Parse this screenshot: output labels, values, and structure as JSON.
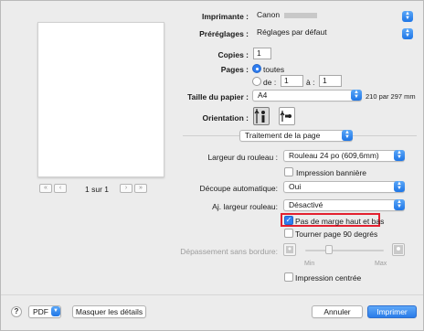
{
  "printer": {
    "label": "Imprimante :",
    "value": "Canon"
  },
  "presets": {
    "label": "Préréglages :",
    "value": "Réglages par défaut"
  },
  "copies": {
    "label": "Copies :",
    "value": "1"
  },
  "pages": {
    "label": "Pages :",
    "all_label": "toutes",
    "from_label": "de :",
    "from_value": "1",
    "to_label": "à :",
    "to_value": "1",
    "selected": "toutes"
  },
  "paper_size": {
    "label": "Taille du papier :",
    "value": "A4",
    "dimensions": "210 par 297 mm"
  },
  "orientation": {
    "label": "Orientation :",
    "selected": "portrait"
  },
  "section": {
    "value": "Traitement de la page"
  },
  "roll_width": {
    "label": "Largeur du rouleau :",
    "value": "Rouleau 24 po (609,6mm)"
  },
  "banner": {
    "label": "Impression bannière",
    "checked": false
  },
  "auto_cut": {
    "label": "Découpe automatique:",
    "value": "Oui"
  },
  "adj_roll_width": {
    "label": "Aj. largeur rouleau:",
    "value": "Désactivé"
  },
  "no_top_bottom_margin": {
    "label": "Pas de marge haut et bas",
    "checked": true
  },
  "rotate_90": {
    "label": "Tourner page 90 degrés",
    "checked": false
  },
  "borderless_overflow": {
    "label": "Dépassement sans bordure:",
    "min_label": "Min",
    "max_label": "Max"
  },
  "centered_print": {
    "label": "Impression centrée",
    "checked": false
  },
  "page_nav": {
    "first": "«",
    "prev": "‹",
    "indicator": "1 sur 1",
    "next": "›",
    "last": "»"
  },
  "footer": {
    "help": "?",
    "pdf": "PDF",
    "hide_details": "Masquer les détails",
    "cancel": "Annuler",
    "print": "Imprimer"
  },
  "colors": {
    "accent": "#2f7df0",
    "highlight": "#e3202f"
  }
}
